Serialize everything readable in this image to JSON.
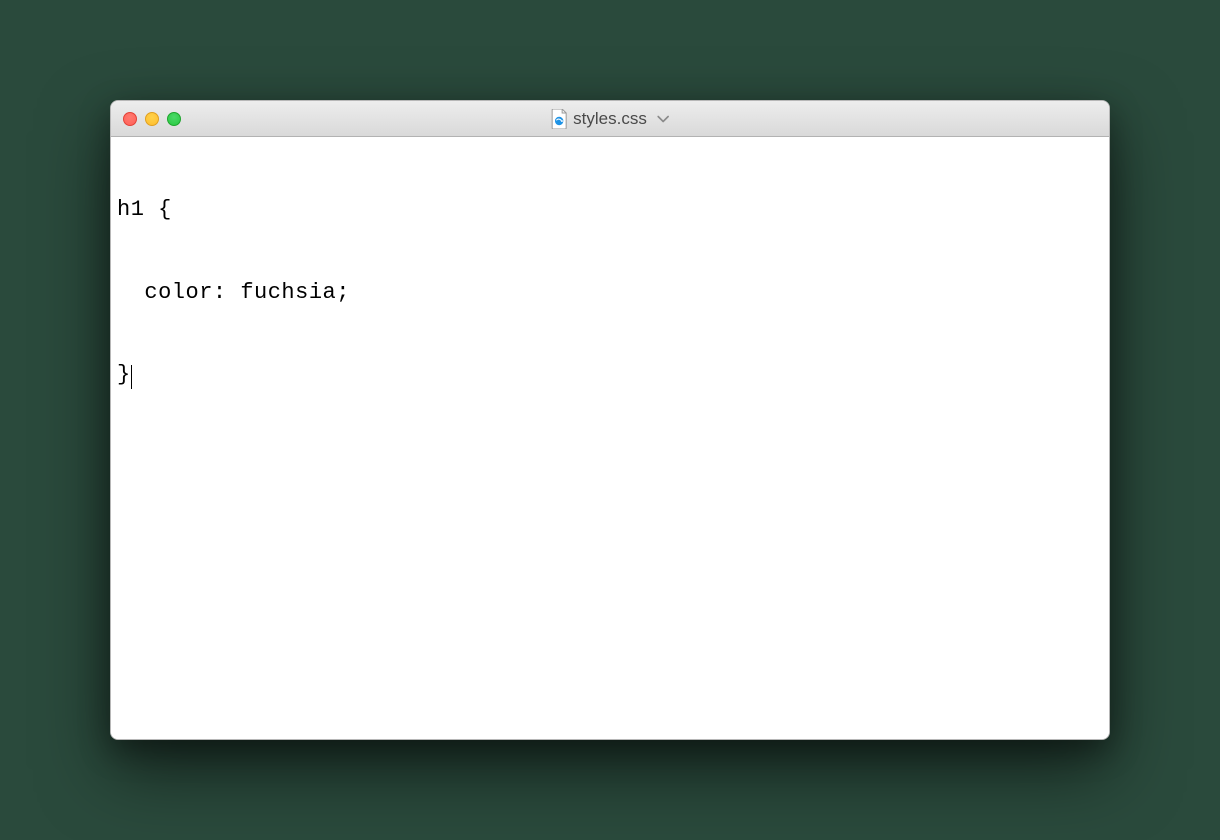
{
  "window": {
    "title": "styles.css",
    "traffic_lights": {
      "close": "close-icon",
      "minimize": "minimize-icon",
      "maximize": "maximize-icon"
    }
  },
  "editor": {
    "lines": [
      "h1 {",
      "  color: fuchsia;",
      "}"
    ],
    "cursor_line": 2,
    "cursor_col": 1
  },
  "colors": {
    "bg": "#2a4a3c",
    "window_bg": "#ffffff",
    "titlebar_top": "#ededed",
    "titlebar_bottom": "#d9d9d9",
    "text": "#000000",
    "title_text": "#4a4a4a"
  }
}
